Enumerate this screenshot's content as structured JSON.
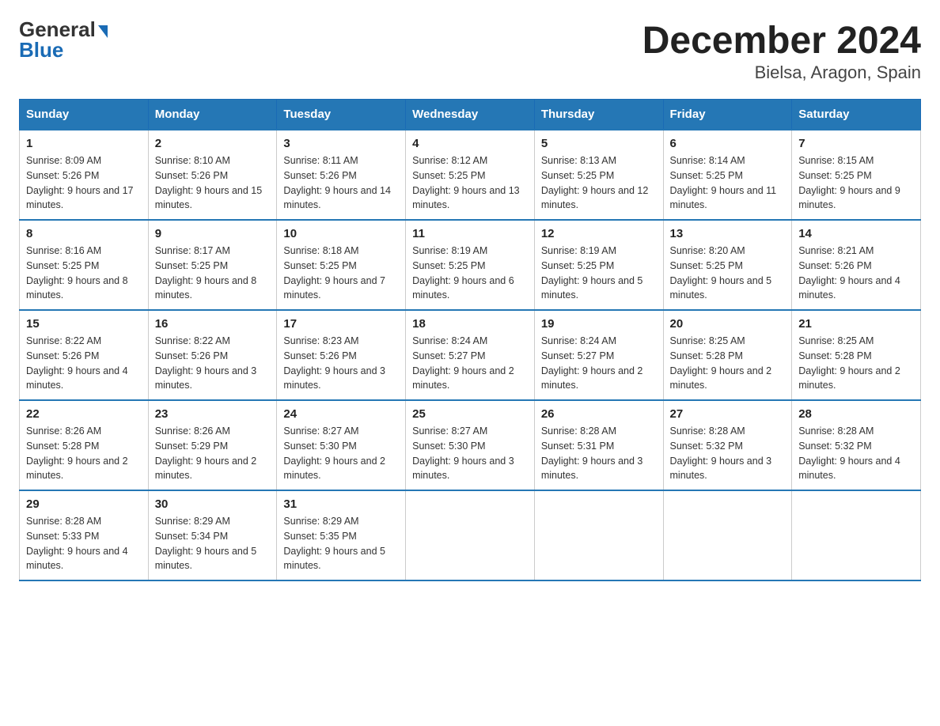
{
  "logo": {
    "general": "General",
    "blue": "Blue",
    "arrow": "▶"
  },
  "title": {
    "month": "December 2024",
    "location": "Bielsa, Aragon, Spain"
  },
  "days_of_week": [
    "Sunday",
    "Monday",
    "Tuesday",
    "Wednesday",
    "Thursday",
    "Friday",
    "Saturday"
  ],
  "weeks": [
    [
      {
        "day": "1",
        "sunrise": "Sunrise: 8:09 AM",
        "sunset": "Sunset: 5:26 PM",
        "daylight": "Daylight: 9 hours and 17 minutes."
      },
      {
        "day": "2",
        "sunrise": "Sunrise: 8:10 AM",
        "sunset": "Sunset: 5:26 PM",
        "daylight": "Daylight: 9 hours and 15 minutes."
      },
      {
        "day": "3",
        "sunrise": "Sunrise: 8:11 AM",
        "sunset": "Sunset: 5:26 PM",
        "daylight": "Daylight: 9 hours and 14 minutes."
      },
      {
        "day": "4",
        "sunrise": "Sunrise: 8:12 AM",
        "sunset": "Sunset: 5:25 PM",
        "daylight": "Daylight: 9 hours and 13 minutes."
      },
      {
        "day": "5",
        "sunrise": "Sunrise: 8:13 AM",
        "sunset": "Sunset: 5:25 PM",
        "daylight": "Daylight: 9 hours and 12 minutes."
      },
      {
        "day": "6",
        "sunrise": "Sunrise: 8:14 AM",
        "sunset": "Sunset: 5:25 PM",
        "daylight": "Daylight: 9 hours and 11 minutes."
      },
      {
        "day": "7",
        "sunrise": "Sunrise: 8:15 AM",
        "sunset": "Sunset: 5:25 PM",
        "daylight": "Daylight: 9 hours and 9 minutes."
      }
    ],
    [
      {
        "day": "8",
        "sunrise": "Sunrise: 8:16 AM",
        "sunset": "Sunset: 5:25 PM",
        "daylight": "Daylight: 9 hours and 8 minutes."
      },
      {
        "day": "9",
        "sunrise": "Sunrise: 8:17 AM",
        "sunset": "Sunset: 5:25 PM",
        "daylight": "Daylight: 9 hours and 8 minutes."
      },
      {
        "day": "10",
        "sunrise": "Sunrise: 8:18 AM",
        "sunset": "Sunset: 5:25 PM",
        "daylight": "Daylight: 9 hours and 7 minutes."
      },
      {
        "day": "11",
        "sunrise": "Sunrise: 8:19 AM",
        "sunset": "Sunset: 5:25 PM",
        "daylight": "Daylight: 9 hours and 6 minutes."
      },
      {
        "day": "12",
        "sunrise": "Sunrise: 8:19 AM",
        "sunset": "Sunset: 5:25 PM",
        "daylight": "Daylight: 9 hours and 5 minutes."
      },
      {
        "day": "13",
        "sunrise": "Sunrise: 8:20 AM",
        "sunset": "Sunset: 5:25 PM",
        "daylight": "Daylight: 9 hours and 5 minutes."
      },
      {
        "day": "14",
        "sunrise": "Sunrise: 8:21 AM",
        "sunset": "Sunset: 5:26 PM",
        "daylight": "Daylight: 9 hours and 4 minutes."
      }
    ],
    [
      {
        "day": "15",
        "sunrise": "Sunrise: 8:22 AM",
        "sunset": "Sunset: 5:26 PM",
        "daylight": "Daylight: 9 hours and 4 minutes."
      },
      {
        "day": "16",
        "sunrise": "Sunrise: 8:22 AM",
        "sunset": "Sunset: 5:26 PM",
        "daylight": "Daylight: 9 hours and 3 minutes."
      },
      {
        "day": "17",
        "sunrise": "Sunrise: 8:23 AM",
        "sunset": "Sunset: 5:26 PM",
        "daylight": "Daylight: 9 hours and 3 minutes."
      },
      {
        "day": "18",
        "sunrise": "Sunrise: 8:24 AM",
        "sunset": "Sunset: 5:27 PM",
        "daylight": "Daylight: 9 hours and 2 minutes."
      },
      {
        "day": "19",
        "sunrise": "Sunrise: 8:24 AM",
        "sunset": "Sunset: 5:27 PM",
        "daylight": "Daylight: 9 hours and 2 minutes."
      },
      {
        "day": "20",
        "sunrise": "Sunrise: 8:25 AM",
        "sunset": "Sunset: 5:28 PM",
        "daylight": "Daylight: 9 hours and 2 minutes."
      },
      {
        "day": "21",
        "sunrise": "Sunrise: 8:25 AM",
        "sunset": "Sunset: 5:28 PM",
        "daylight": "Daylight: 9 hours and 2 minutes."
      }
    ],
    [
      {
        "day": "22",
        "sunrise": "Sunrise: 8:26 AM",
        "sunset": "Sunset: 5:28 PM",
        "daylight": "Daylight: 9 hours and 2 minutes."
      },
      {
        "day": "23",
        "sunrise": "Sunrise: 8:26 AM",
        "sunset": "Sunset: 5:29 PM",
        "daylight": "Daylight: 9 hours and 2 minutes."
      },
      {
        "day": "24",
        "sunrise": "Sunrise: 8:27 AM",
        "sunset": "Sunset: 5:30 PM",
        "daylight": "Daylight: 9 hours and 2 minutes."
      },
      {
        "day": "25",
        "sunrise": "Sunrise: 8:27 AM",
        "sunset": "Sunset: 5:30 PM",
        "daylight": "Daylight: 9 hours and 3 minutes."
      },
      {
        "day": "26",
        "sunrise": "Sunrise: 8:28 AM",
        "sunset": "Sunset: 5:31 PM",
        "daylight": "Daylight: 9 hours and 3 minutes."
      },
      {
        "day": "27",
        "sunrise": "Sunrise: 8:28 AM",
        "sunset": "Sunset: 5:32 PM",
        "daylight": "Daylight: 9 hours and 3 minutes."
      },
      {
        "day": "28",
        "sunrise": "Sunrise: 8:28 AM",
        "sunset": "Sunset: 5:32 PM",
        "daylight": "Daylight: 9 hours and 4 minutes."
      }
    ],
    [
      {
        "day": "29",
        "sunrise": "Sunrise: 8:28 AM",
        "sunset": "Sunset: 5:33 PM",
        "daylight": "Daylight: 9 hours and 4 minutes."
      },
      {
        "day": "30",
        "sunrise": "Sunrise: 8:29 AM",
        "sunset": "Sunset: 5:34 PM",
        "daylight": "Daylight: 9 hours and 5 minutes."
      },
      {
        "day": "31",
        "sunrise": "Sunrise: 8:29 AM",
        "sunset": "Sunset: 5:35 PM",
        "daylight": "Daylight: 9 hours and 5 minutes."
      },
      {
        "day": "",
        "sunrise": "",
        "sunset": "",
        "daylight": ""
      },
      {
        "day": "",
        "sunrise": "",
        "sunset": "",
        "daylight": ""
      },
      {
        "day": "",
        "sunrise": "",
        "sunset": "",
        "daylight": ""
      },
      {
        "day": "",
        "sunrise": "",
        "sunset": "",
        "daylight": ""
      }
    ]
  ]
}
